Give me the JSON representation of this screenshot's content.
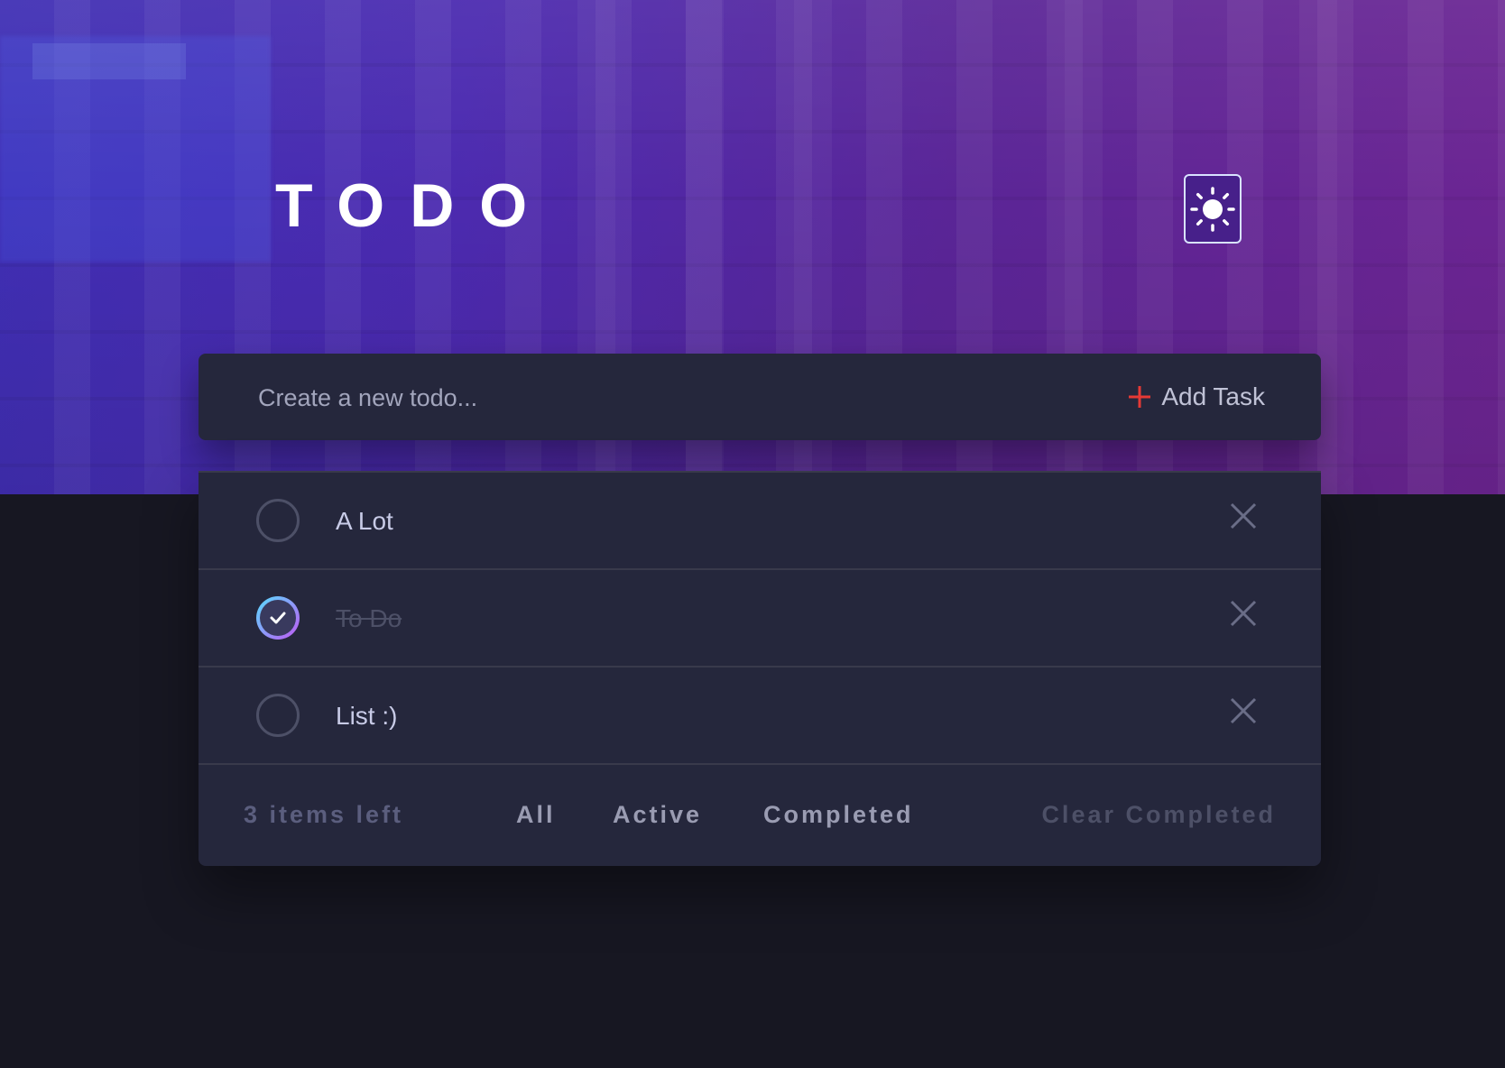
{
  "app": {
    "title": "TODO"
  },
  "theme_toggle": {
    "icon": "sun-icon"
  },
  "new_todo": {
    "placeholder": "Create a new todo...",
    "value": "",
    "add_label": "Add Task",
    "add_icon": "plus-icon"
  },
  "todos": [
    {
      "text": "A Lot",
      "completed": false
    },
    {
      "text": "To Do",
      "completed": true
    },
    {
      "text": "List :)",
      "completed": false
    }
  ],
  "footer": {
    "items_left": "3 items left",
    "filters": [
      "All",
      "Active",
      "Completed"
    ],
    "clear_label": "Clear Completed"
  },
  "colors": {
    "accent_red": "#e53935",
    "check_gradient_start": "#57ddff",
    "check_gradient_end": "#c058f3",
    "card_bg": "#25273c",
    "page_bg": "#171722"
  }
}
